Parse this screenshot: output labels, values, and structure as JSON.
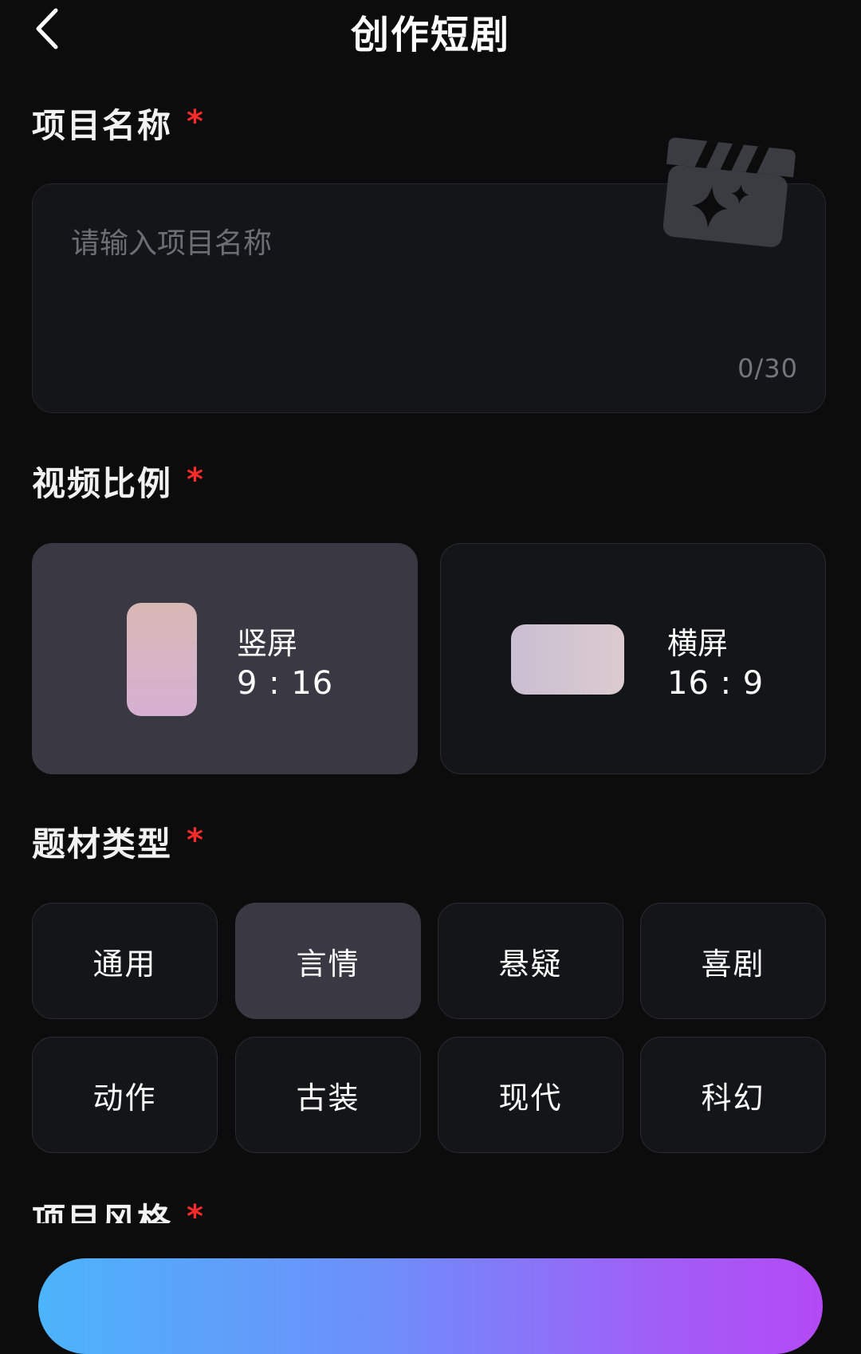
{
  "header": {
    "title": "创作短剧",
    "back_icon": "chevron-left-icon"
  },
  "project_name": {
    "label": "项目名称",
    "required_mark": "*",
    "placeholder": "请输入项目名称",
    "value": "",
    "counter": "0/30",
    "decor_icon": "clapperboard-sparkle-icon"
  },
  "video_ratio": {
    "label": "视频比例",
    "required_mark": "*",
    "options": [
      {
        "name": "竖屏",
        "ratio": "9 : 16",
        "selected": true
      },
      {
        "name": "横屏",
        "ratio": "16 : 9",
        "selected": false
      }
    ]
  },
  "genre": {
    "label": "题材类型",
    "required_mark": "*",
    "options": [
      {
        "label": "通用",
        "selected": false
      },
      {
        "label": "言情",
        "selected": true
      },
      {
        "label": "悬疑",
        "selected": false
      },
      {
        "label": "喜剧",
        "selected": false
      },
      {
        "label": "动作",
        "selected": false
      },
      {
        "label": "古装",
        "selected": false
      },
      {
        "label": "现代",
        "selected": false
      },
      {
        "label": "科幻",
        "selected": false
      }
    ]
  },
  "project_style": {
    "label": "项目风格",
    "required_mark": "*"
  },
  "colors": {
    "background": "#0c0c0d",
    "card": "#141518",
    "selected_card": "#3a3842",
    "required_star": "#ff2b2b",
    "button_gradient_start": "#4cb4fb",
    "button_gradient_end": "#b34af5"
  }
}
